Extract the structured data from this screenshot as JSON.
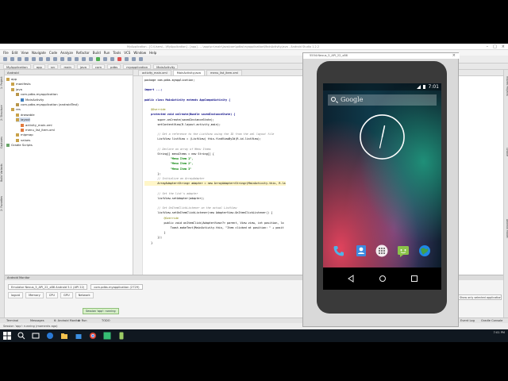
{
  "ide": {
    "window_title": "MyApplication - [C:\\Users\\...\\MyApplication] - [app] - ...\\app\\src\\main\\java\\com\\pdbs\\myapplication\\MainActivity.java - Android Studio 1.2.2",
    "menu": [
      "File",
      "Edit",
      "View",
      "Navigate",
      "Code",
      "Analyze",
      "Refactor",
      "Build",
      "Run",
      "Tools",
      "VCS",
      "Window",
      "Help"
    ],
    "breadcrumbs": [
      "MyApplication",
      "app",
      "src",
      "main",
      "java",
      "com",
      "pdbs",
      "myapplication",
      "MainActivity"
    ],
    "project_header": "Android",
    "tree": [
      {
        "label": "app",
        "indent": 0,
        "icon": "folder"
      },
      {
        "label": "manifests",
        "indent": 1,
        "icon": "folder"
      },
      {
        "label": "java",
        "indent": 1,
        "icon": "folder"
      },
      {
        "label": "com.pdbs.myapplication",
        "indent": 2,
        "icon": "package"
      },
      {
        "label": "MainActivity",
        "indent": 3,
        "icon": "class"
      },
      {
        "label": "com.pdbs.myapplication (androidTest)",
        "indent": 2,
        "icon": "package"
      },
      {
        "label": "res",
        "indent": 1,
        "icon": "folder"
      },
      {
        "label": "drawable",
        "indent": 2,
        "icon": "folder"
      },
      {
        "label": "layout",
        "indent": 2,
        "icon": "folder"
      },
      {
        "label": "activity_main.xml",
        "indent": 3,
        "icon": "xml"
      },
      {
        "label": "menu_list_item.xml",
        "indent": 3,
        "icon": "xml"
      },
      {
        "label": "mipmap",
        "indent": 2,
        "icon": "folder"
      },
      {
        "label": "values",
        "indent": 2,
        "icon": "folder"
      },
      {
        "label": "Gradle Scripts",
        "indent": 0,
        "icon": "gradle"
      }
    ],
    "editor_tabs": [
      "activity_main.xml",
      "MainActivity.java",
      "menu_list_item.xml"
    ],
    "code_lines": [
      {
        "kind": "plain",
        "text": "package com.pdbs.myapplication;"
      },
      {
        "kind": "blank",
        "text": ""
      },
      {
        "kind": "kw",
        "text": "import ...;"
      },
      {
        "kind": "blank",
        "text": ""
      },
      {
        "kind": "kw",
        "text": "public class MainActivity extends AppCompatActivity {"
      },
      {
        "kind": "blank",
        "text": ""
      },
      {
        "kind": "an",
        "text": "    @Override"
      },
      {
        "kind": "kw",
        "text": "    protected void onCreate(Bundle savedInstanceState) {"
      },
      {
        "kind": "plain",
        "text": "        super.onCreate(savedInstanceState);"
      },
      {
        "kind": "plain",
        "text": "        setContentView(R.layout.activity_main);"
      },
      {
        "kind": "blank",
        "text": ""
      },
      {
        "kind": "cm",
        "text": "        // Get a reference to the ListView using the ID from the xml layout file"
      },
      {
        "kind": "plain",
        "text": "        ListView listView = (ListView) this.findViewById(R.id.listView);"
      },
      {
        "kind": "blank",
        "text": ""
      },
      {
        "kind": "cm",
        "text": "        // Declare an array of Menu Items"
      },
      {
        "kind": "plain",
        "text": "        String[] menuItems = new String[] {"
      },
      {
        "kind": "st",
        "text": "                \"Menu Item 1\","
      },
      {
        "kind": "st",
        "text": "                \"Menu Item 2\","
      },
      {
        "kind": "st",
        "text": "                \"Menu Item 3\""
      },
      {
        "kind": "plain",
        "text": "        };"
      },
      {
        "kind": "cm",
        "text": "        // Initialize an ArrayAdapter"
      },
      {
        "kind": "hl",
        "text": "        ArrayAdapter<String> adapter = new ArrayAdapter<String>(MainActivity.this, R.la"
      },
      {
        "kind": "blank",
        "text": ""
      },
      {
        "kind": "cm",
        "text": "        // Set the list's adapter"
      },
      {
        "kind": "plain",
        "text": "        listView.setAdapter(adapter);"
      },
      {
        "kind": "blank",
        "text": ""
      },
      {
        "kind": "cm",
        "text": "        // Set OnItemClickListener on the actual ListView"
      },
      {
        "kind": "plain",
        "text": "        listView.setOnItemClickListener(new AdapterView.OnItemClickListener() {"
      },
      {
        "kind": "an",
        "text": "            @Override"
      },
      {
        "kind": "plain",
        "text": "            public void onItemClick(AdapterView<?> parent, View view, int position, lo"
      },
      {
        "kind": "plain",
        "text": "                Toast.makeText(MainActivity.this, \"Item clicked at position: \" + posit"
      },
      {
        "kind": "plain",
        "text": "            }"
      },
      {
        "kind": "plain",
        "text": "        });"
      },
      {
        "kind": "plain",
        "text": "    }"
      }
    ],
    "left_tabs": [
      "1: Project",
      "2: Structure",
      "Captures",
      "Build Variants",
      "2: Favorites"
    ],
    "right_tabs": [
      "Maven Projects",
      "Gradle",
      "Android Model"
    ],
    "monitor": {
      "title": "Android Monitor",
      "device_combo": "Emulator Nexus_5_API_22_x86 Android 5.1 (API 22)",
      "process_combo": "com.pdbs.myapplication (2729)",
      "tabs": [
        "logcat",
        "Memory",
        "CPU",
        "GPU",
        "Network"
      ],
      "filter": "Show only selected application"
    },
    "bottom_tools": [
      "Terminal",
      "Messages",
      "6: Android Monitor",
      "4: Run",
      "TODO"
    ],
    "bottom_right": [
      "Event Log",
      "Gradle Console"
    ],
    "tooltip": "Session 'app': running",
    "status_line": "Session 'app': running (moments ago)"
  },
  "emulator": {
    "window_title": "5554:Nexus_5_API_22_x86",
    "time": "7:01",
    "search_label": "Google",
    "clock_time": "7:01"
  },
  "taskbar": {
    "clock": "7:01 PM"
  }
}
